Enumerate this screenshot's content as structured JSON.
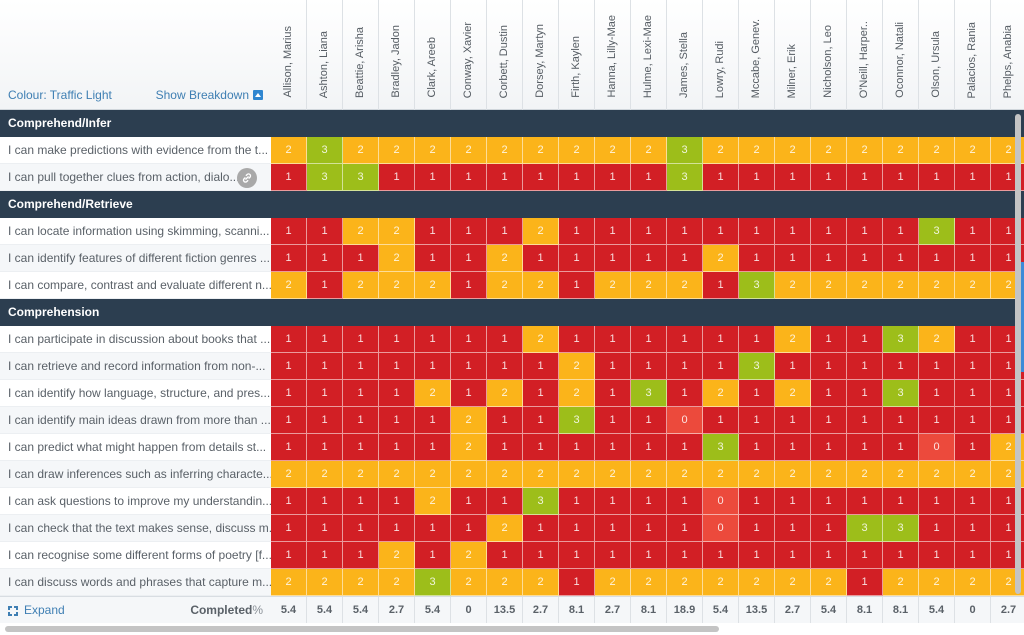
{
  "header": {
    "colour_label": "Colour: Traffic Light",
    "breakdown_label": "Show Breakdown"
  },
  "colors": {
    "0": "#ec4a3c",
    "1": "#d21f25",
    "2": "#fbb41a",
    "3": "#9dbe1a",
    "group_bg": "#2c3e50",
    "link": "#3f7fb3"
  },
  "students": [
    "Allison, Marius",
    "Ashton, Liana",
    "Beattie, Arisha",
    "Bradley, Jadon",
    "Clark, Areeb",
    "Conway, Xavier",
    "Corbett, Dustin",
    "Dorsey, Martyn",
    "Firth, Kaylen",
    "Hanna, Lilly-Mae",
    "Hulme, Lexi-Mae",
    "James, Stella",
    "Lowry, Rudi",
    "Mccabe, Genev.",
    "Milner, Erik",
    "Nicholson, Leo",
    "O'Neill, Harper..",
    "Oconnor, Natali",
    "Olson, Ursula",
    "Palacios, Rania",
    "Phelps, Anabia"
  ],
  "groups": [
    {
      "name": "Comprehend/Infer",
      "items": [
        {
          "label": "I can make predictions with evidence from the t...",
          "scores": [
            2,
            3,
            2,
            2,
            2,
            2,
            2,
            2,
            2,
            2,
            2,
            3,
            2,
            2,
            2,
            2,
            2,
            2,
            2,
            2,
            2
          ]
        },
        {
          "label": "I can pull together clues from action, dialo...",
          "has_link": true,
          "scores": [
            1,
            3,
            3,
            1,
            1,
            1,
            1,
            1,
            1,
            1,
            1,
            3,
            1,
            1,
            1,
            1,
            1,
            1,
            1,
            1,
            1
          ]
        }
      ]
    },
    {
      "name": "Comprehend/Retrieve",
      "items": [
        {
          "label": "I can locate information using skimming, scanni...",
          "scores": [
            1,
            1,
            2,
            2,
            1,
            1,
            1,
            2,
            1,
            1,
            1,
            1,
            1,
            1,
            1,
            1,
            1,
            1,
            3,
            1,
            1
          ]
        },
        {
          "label": "I can identify features of different fiction genres ...",
          "scores": [
            1,
            1,
            1,
            2,
            1,
            1,
            2,
            1,
            1,
            1,
            1,
            1,
            2,
            1,
            1,
            1,
            1,
            1,
            1,
            1,
            1
          ]
        },
        {
          "label": "I can compare, contrast and evaluate different n...",
          "scores": [
            2,
            1,
            2,
            2,
            2,
            1,
            2,
            2,
            1,
            2,
            2,
            2,
            1,
            3,
            2,
            2,
            2,
            2,
            2,
            2,
            2
          ]
        }
      ]
    },
    {
      "name": "Comprehension",
      "items": [
        {
          "label": "I can participate in discussion about books that ...",
          "scores": [
            1,
            1,
            1,
            1,
            1,
            1,
            1,
            2,
            1,
            1,
            1,
            1,
            1,
            1,
            2,
            1,
            1,
            3,
            2,
            1,
            1
          ]
        },
        {
          "label": "I can retrieve and record information from non-...",
          "scores": [
            1,
            1,
            1,
            1,
            1,
            1,
            1,
            1,
            2,
            1,
            1,
            1,
            1,
            3,
            1,
            1,
            1,
            1,
            1,
            1,
            1
          ]
        },
        {
          "label": "I can identify how language, structure, and pres...",
          "scores": [
            1,
            1,
            1,
            1,
            2,
            1,
            2,
            1,
            2,
            1,
            3,
            1,
            2,
            1,
            2,
            1,
            1,
            3,
            1,
            1,
            1
          ]
        },
        {
          "label": "I can identify main ideas drawn from more than ...",
          "scores": [
            1,
            1,
            1,
            1,
            1,
            2,
            1,
            1,
            3,
            1,
            1,
            0,
            1,
            1,
            1,
            1,
            1,
            1,
            1,
            1,
            1
          ]
        },
        {
          "label": "I can predict what might happen from details st...",
          "scores": [
            1,
            1,
            1,
            1,
            1,
            2,
            1,
            1,
            1,
            1,
            1,
            1,
            3,
            1,
            1,
            1,
            1,
            1,
            0,
            1,
            2
          ]
        },
        {
          "label": "I can draw inferences such as inferring characte...",
          "scores": [
            2,
            2,
            2,
            2,
            2,
            2,
            2,
            2,
            2,
            2,
            2,
            2,
            2,
            2,
            2,
            2,
            2,
            2,
            2,
            2,
            2
          ]
        },
        {
          "label": "I can ask questions to improve my understandin...",
          "scores": [
            1,
            1,
            1,
            1,
            2,
            1,
            1,
            3,
            1,
            1,
            1,
            1,
            0,
            1,
            1,
            1,
            1,
            1,
            1,
            1,
            1
          ]
        },
        {
          "label": "I can check that the text makes sense, discuss m...",
          "scores": [
            1,
            1,
            1,
            1,
            1,
            1,
            2,
            1,
            1,
            1,
            1,
            1,
            0,
            1,
            1,
            1,
            3,
            3,
            1,
            1,
            1
          ]
        },
        {
          "label": "I can recognise some different forms of poetry [f...",
          "scores": [
            1,
            1,
            1,
            2,
            1,
            2,
            1,
            1,
            1,
            1,
            1,
            1,
            1,
            1,
            1,
            1,
            1,
            1,
            1,
            1,
            1
          ]
        },
        {
          "label": "I can discuss words and phrases that capture m...",
          "scores": [
            2,
            2,
            2,
            2,
            3,
            2,
            2,
            2,
            1,
            2,
            2,
            2,
            2,
            2,
            2,
            2,
            1,
            2,
            2,
            2,
            2
          ]
        }
      ]
    }
  ],
  "footer": {
    "expand_label": "Expand",
    "completed_label": "Completed",
    "completed_suffix": "%",
    "completed_values": [
      "5.4",
      "5.4",
      "5.4",
      "2.7",
      "5.4",
      "0",
      "13.5",
      "2.7",
      "8.1",
      "2.7",
      "8.1",
      "18.9",
      "5.4",
      "13.5",
      "2.7",
      "5.4",
      "8.1",
      "8.1",
      "5.4",
      "0",
      "2.7"
    ]
  },
  "scroll": {
    "horizontal_fraction_visible": 0.7
  }
}
